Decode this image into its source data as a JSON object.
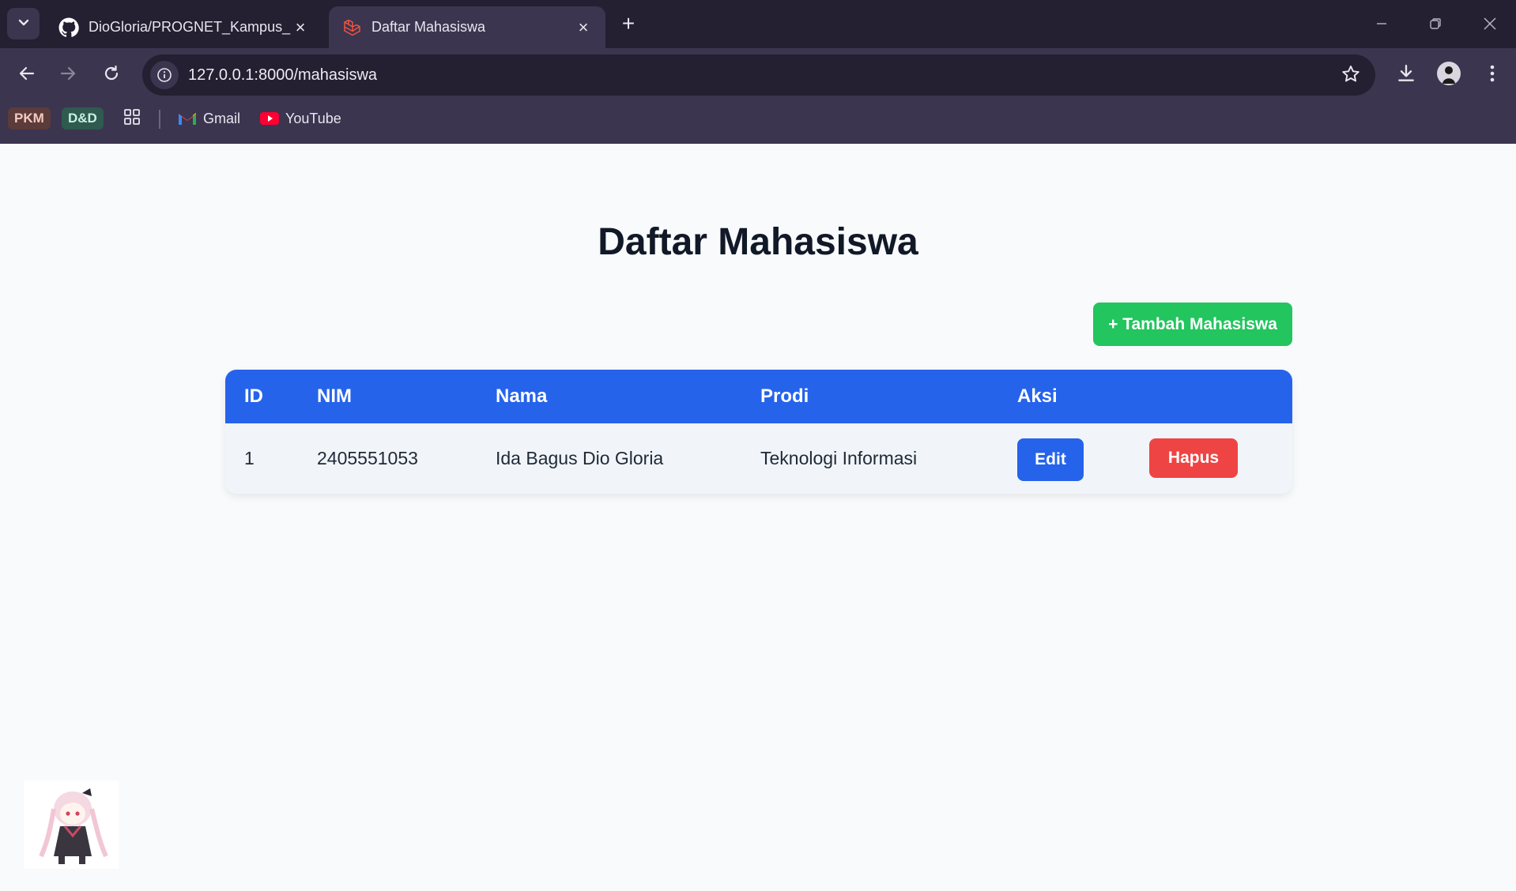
{
  "browser": {
    "tabs": [
      {
        "title": "DioGloria/PROGNET_Kampus_L",
        "icon": "github-icon",
        "active": false
      },
      {
        "title": "Daftar Mahasiswa",
        "icon": "laravel-icon",
        "active": true
      }
    ],
    "url": "127.0.0.1:8000/mahasiswa",
    "bookmarks": [
      {
        "label": "PKM",
        "bg": "#5c3b3b",
        "color": "#f6c9c0"
      },
      {
        "label": "D&D",
        "bg": "#2f5a4f",
        "color": "#c8f0e2"
      },
      {
        "label": "Gmail",
        "icon": "gmail-icon"
      },
      {
        "label": "YouTube",
        "icon": "youtube-icon"
      }
    ]
  },
  "page": {
    "title": "Daftar Mahasiswa",
    "add_button": "+ Tambah Mahasiswa",
    "table": {
      "headers": [
        "ID",
        "NIM",
        "Nama",
        "Prodi",
        "Aksi"
      ],
      "rows": [
        {
          "id": "1",
          "nim": "2405551053",
          "nama": "Ida Bagus Dio Gloria",
          "prodi": "Teknologi Informasi",
          "edit": "Edit",
          "delete": "Hapus"
        }
      ]
    }
  },
  "colors": {
    "header_bg": "#2563eb",
    "add_button": "#22c55e",
    "edit_button": "#2563eb",
    "delete_button": "#ef4444"
  }
}
